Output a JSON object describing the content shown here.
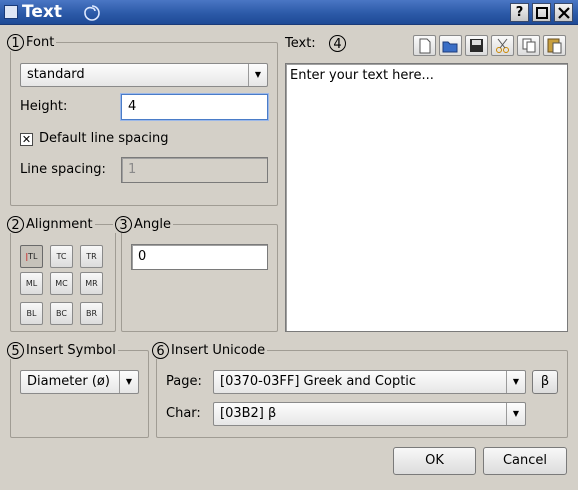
{
  "window": {
    "title": "Text",
    "help_label": "?"
  },
  "font_group": {
    "number": "1",
    "title": "Font",
    "font_value": "standard",
    "height_label": "Height:",
    "height_value": "4",
    "default_spacing_label": "Default line spacing",
    "default_spacing_checked": "✕",
    "line_spacing_label": "Line spacing:",
    "line_spacing_value": "1"
  },
  "alignment_group": {
    "number": "2",
    "title": "Alignment",
    "buttons": [
      "TL",
      "TC",
      "TR",
      "ML",
      "MC",
      "MR",
      "BL",
      "BC",
      "BR"
    ]
  },
  "angle_group": {
    "number": "3",
    "title": "Angle",
    "angle_value": "0"
  },
  "text_group": {
    "label": "Text:",
    "number": "4",
    "placeholder": "Enter your text here..."
  },
  "symbol_group": {
    "number": "5",
    "title": "Insert Symbol",
    "symbol_value": "Diameter (ø)"
  },
  "unicode_group": {
    "number": "6",
    "title": "Insert Unicode",
    "page_label": "Page:",
    "page_value": "[0370-03FF] Greek and Coptic",
    "char_label": "Char:",
    "char_value": "[03B2] β",
    "insert_char": "β"
  },
  "buttons": {
    "ok": "OK",
    "cancel": "Cancel"
  }
}
